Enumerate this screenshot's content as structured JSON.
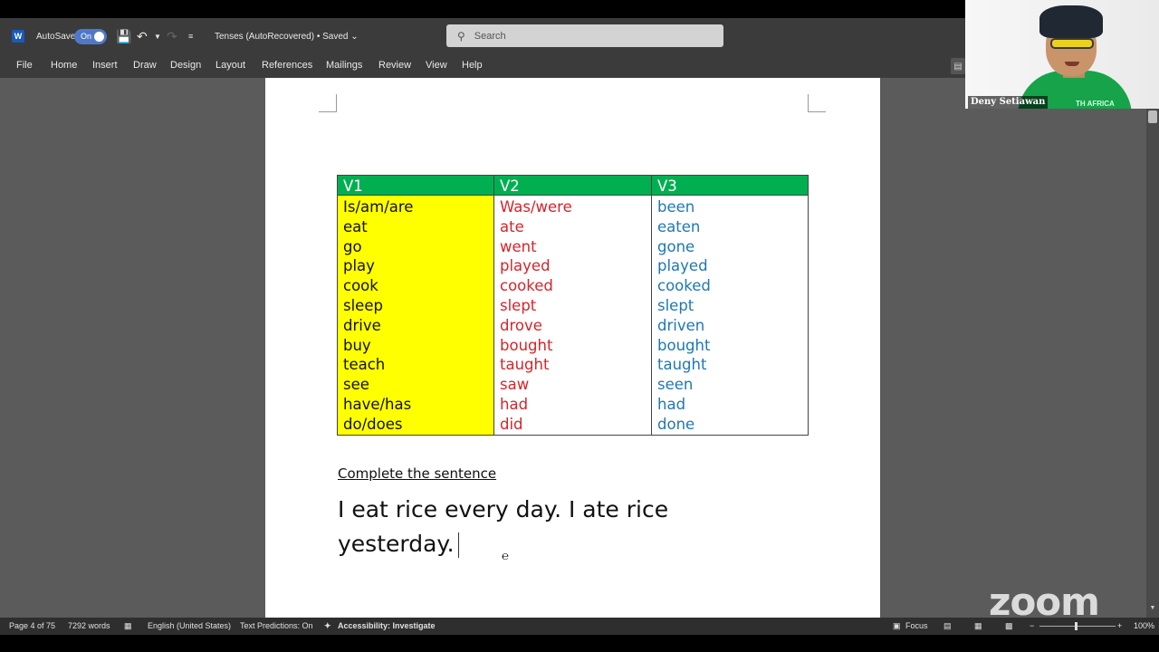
{
  "app": {
    "autosave_label": "AutoSave",
    "autosave_state": "On",
    "doc_title": "Tenses (AutoRecovered) • Saved",
    "search_placeholder": "Search"
  },
  "menu": [
    "File",
    "Home",
    "Insert",
    "Draw",
    "Design",
    "Layout",
    "References",
    "Mailings",
    "Review",
    "View",
    "Help"
  ],
  "icons": {
    "app": "word-logo-icon",
    "save": "save-icon",
    "undo": "undo-icon",
    "redo": "redo-icon",
    "search": "search-icon",
    "comment": "comment-icon"
  },
  "document": {
    "table": {
      "headers": [
        "V1",
        "V2",
        "V3"
      ],
      "header_color": "#00b050",
      "v1_color": "#ffff00",
      "v2_text_color": "#d6242a",
      "v3_text_color": "#1f77b4",
      "v1": [
        "Is/am/are",
        "eat",
        "go",
        "play",
        "cook",
        "sleep",
        "drive",
        "buy",
        "teach",
        "see",
        "have/has",
        "do/does"
      ],
      "v2": [
        "Was/were",
        "ate",
        "went",
        "played",
        "cooked",
        "slept",
        "drove",
        "bought",
        "taught",
        "saw",
        "had",
        "did"
      ],
      "v3": [
        "been",
        "eaten",
        "gone",
        "played",
        "cooked",
        "slept",
        "driven",
        "bought",
        "taught",
        "seen",
        "had",
        "done"
      ]
    },
    "section_heading": "Complete the sentence",
    "sentence_line1": "I eat rice every day. I ate rice",
    "sentence_line2": "yesterday."
  },
  "status": {
    "page": "Page 4 of 75",
    "words": "7292 words",
    "language": "English (United States)",
    "text_predictions": "Text Predictions: On",
    "accessibility": "Accessibility: Investigate",
    "focus": "Focus",
    "zoom": "100%"
  },
  "video": {
    "participant_name": "Deny Setiawan",
    "shirt_text": "TH AFRICA",
    "watermark": "zoom"
  }
}
